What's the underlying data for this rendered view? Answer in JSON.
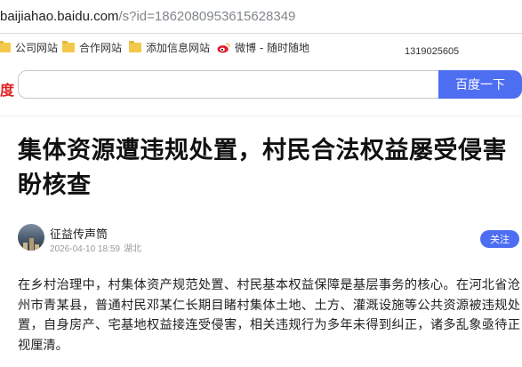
{
  "browser": {
    "url_host": "baijiahao.baidu.com",
    "url_path": "/s?id=1862080953615628349",
    "bookmarks": [
      {
        "label": "公司网站",
        "icon": "folder-icon"
      },
      {
        "label": "合作网站",
        "icon": "folder-icon"
      },
      {
        "label": "添加信息网站",
        "icon": "folder-icon"
      },
      {
        "label": "微博 - 随时随地",
        "icon": "weibo-icon"
      }
    ],
    "side_number": "1319025605"
  },
  "search": {
    "brand_fragment": "度",
    "placeholder": "",
    "button_label": "百度一下",
    "button_color": "#4e6ef2"
  },
  "article": {
    "title": "集体资源遭违规处置，村民合法权益屡受侵害盼核查",
    "author": "征益传声筒",
    "date": "2026-04-10 18:59",
    "location": "湖北",
    "follow_label": "关注",
    "body": "在乡村治理中，村集体资产规范处置、村民基本权益保障是基层事务的核心。在河北省沧州市青某县，普通村民邓某仁长期目睹村集体土地、土方、灌溉设施等公共资源被违规处置，自身房产、宅基地权益接连受侵害，相关违规行为多年未得到纠正，诸多乱象亟待正视厘清。"
  }
}
